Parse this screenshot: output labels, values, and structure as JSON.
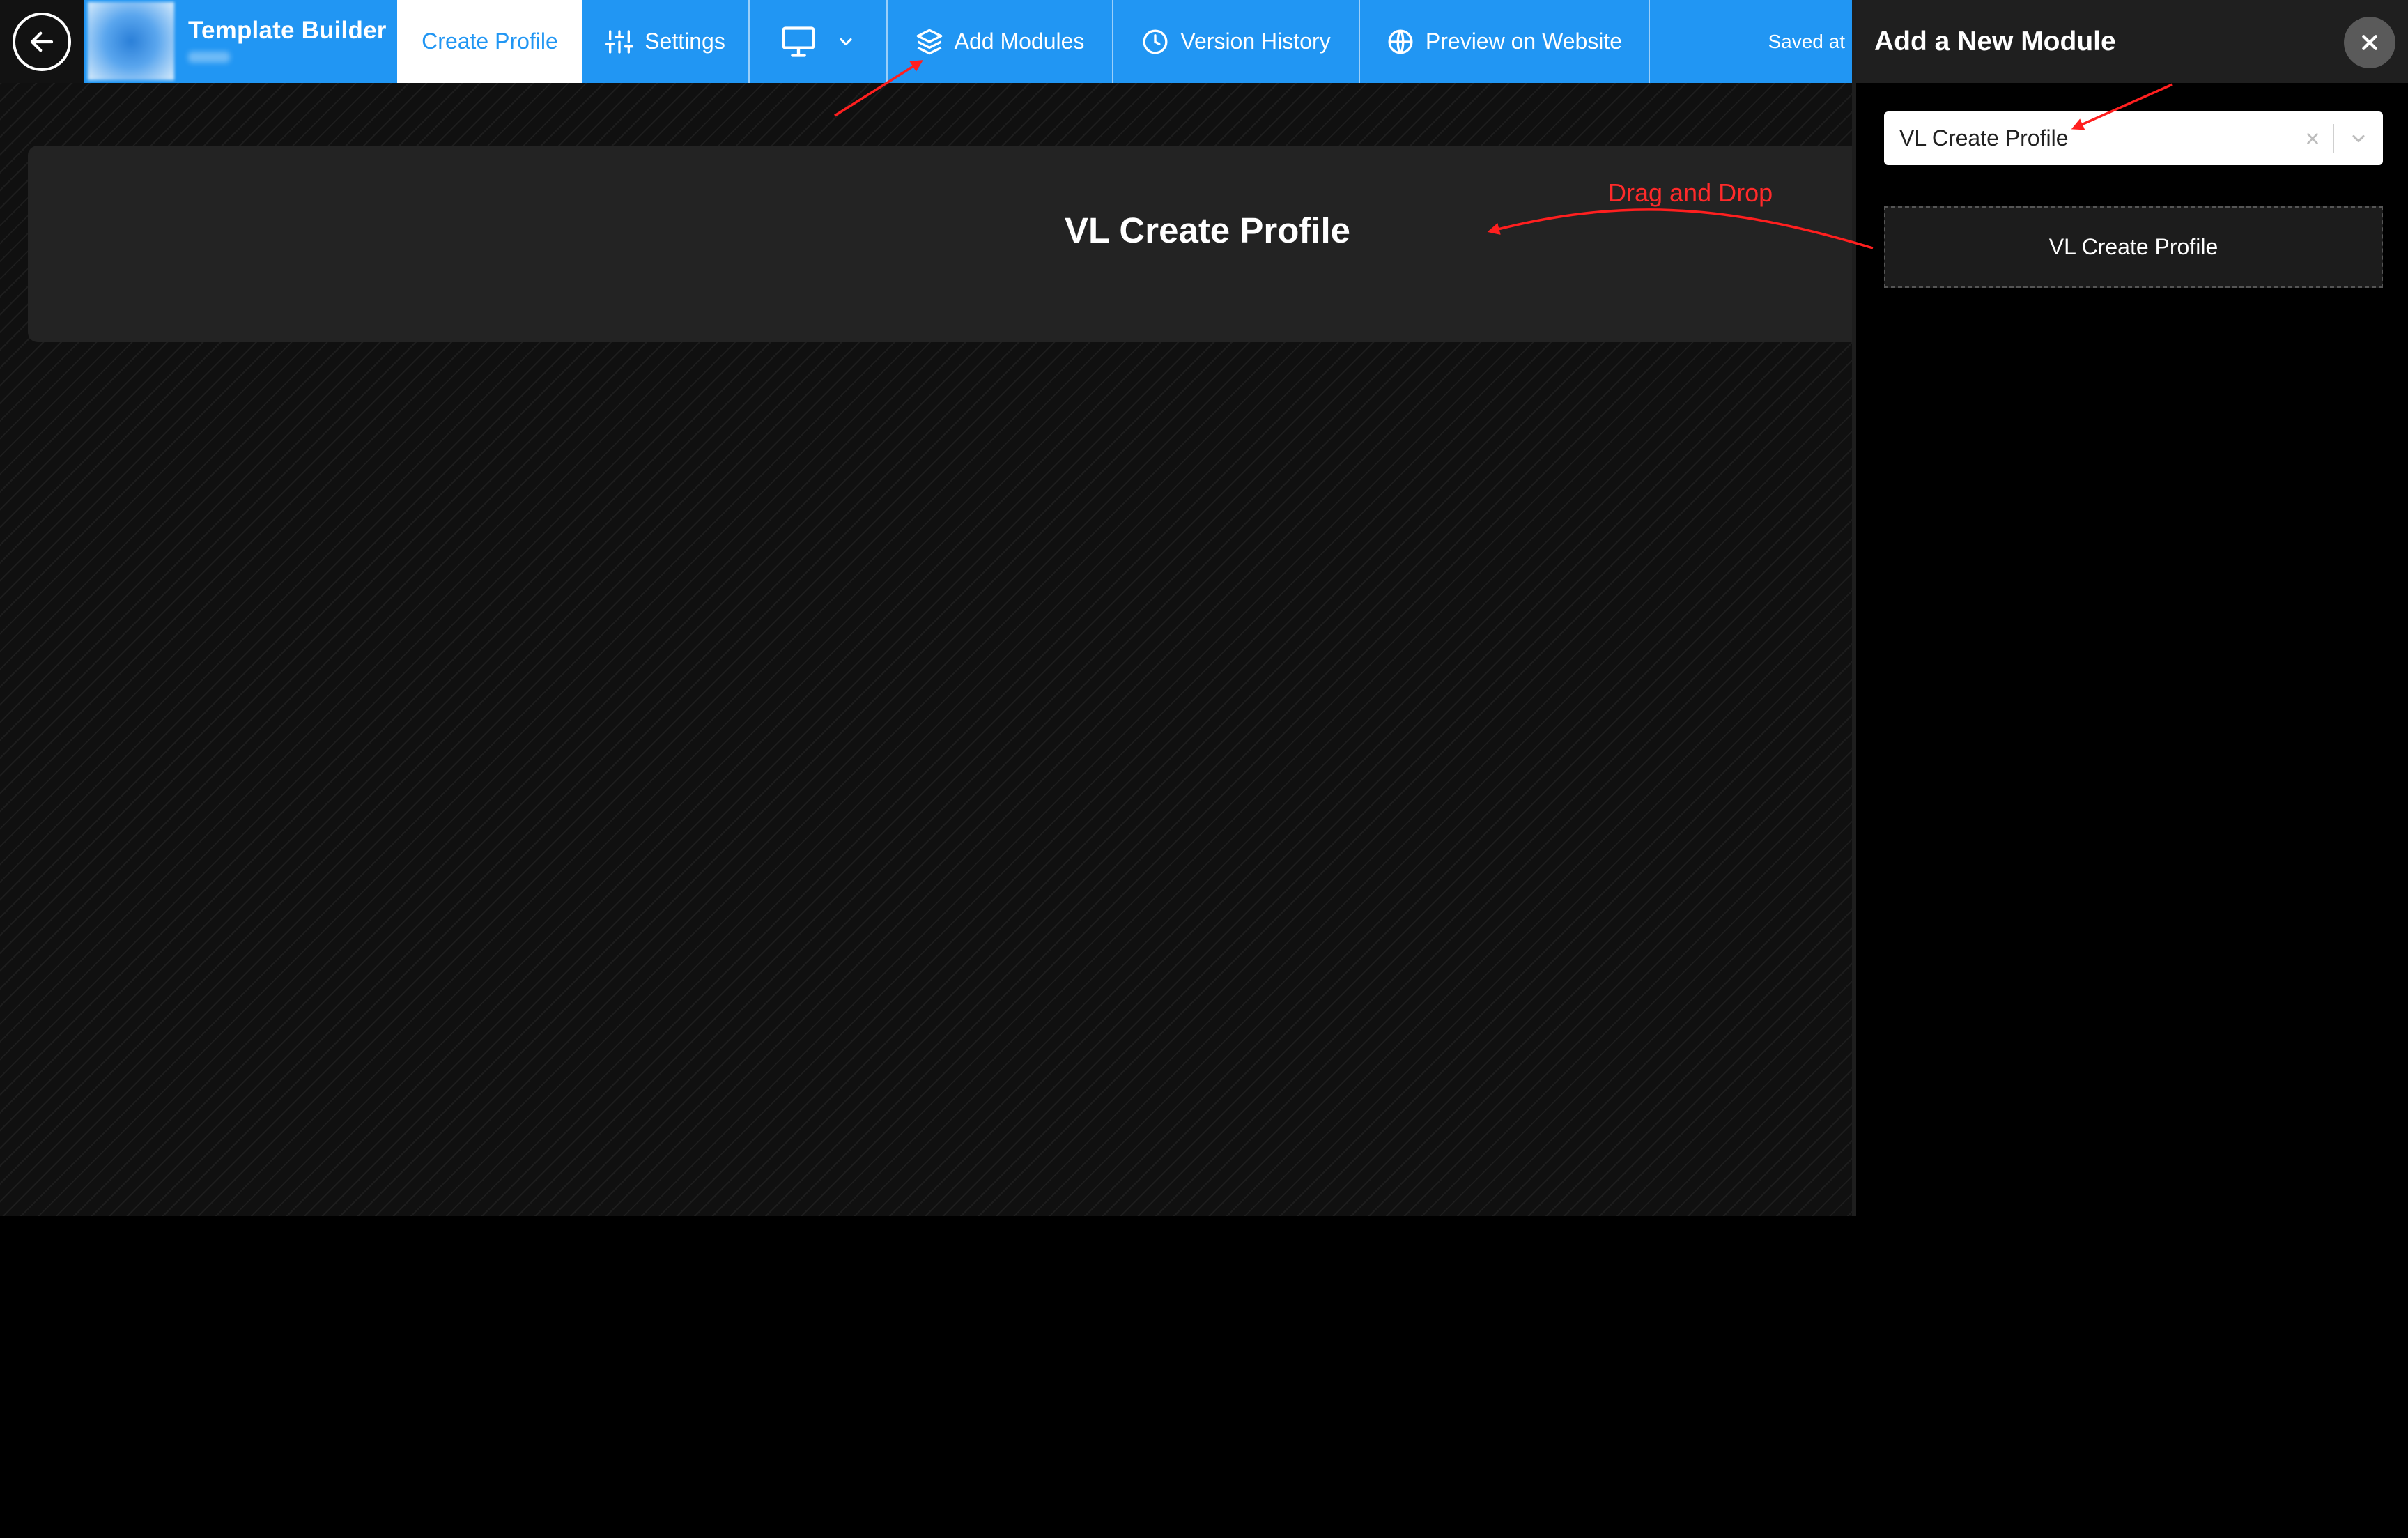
{
  "header": {
    "app_title": "Template Builder",
    "tabs": [
      {
        "label": "Create Profile",
        "icon": "none"
      },
      {
        "label": "Settings",
        "icon": "sliders-icon"
      },
      {
        "label": "",
        "icon": "monitor-icon"
      },
      {
        "label": "Add Modules",
        "icon": "layers-icon"
      },
      {
        "label": "Version History",
        "icon": "clock-icon"
      },
      {
        "label": "Preview on Website",
        "icon": "globe-icon"
      }
    ],
    "saved_status": "Saved at"
  },
  "canvas": {
    "module_title": "VL Create Profile",
    "annotation": "Drag and Drop"
  },
  "panel": {
    "title": "Add a New Module",
    "select_value": "VL Create Profile",
    "module_item_label": "VL Create Profile"
  },
  "colors": {
    "primary": "#2196f3",
    "annotation": "#ff2a2a",
    "panel_header": "#1f1f1f",
    "module_bg": "#232323"
  }
}
